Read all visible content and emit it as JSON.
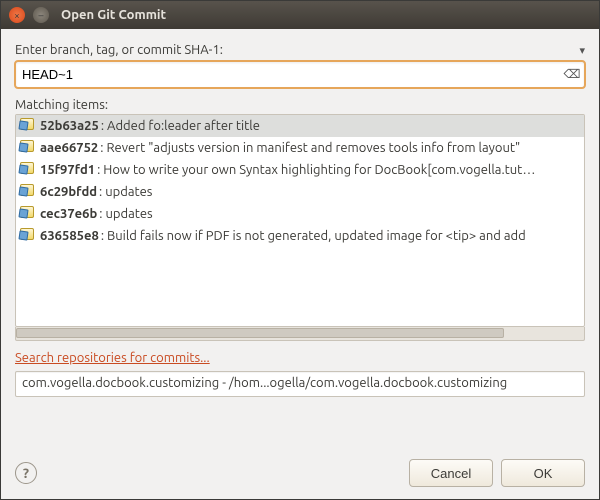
{
  "window": {
    "title": "Open Git Commit"
  },
  "prompt": "Enter branch, tag, or commit SHA-1:",
  "input": {
    "value": "HEAD~1"
  },
  "matching_label": "Matching items:",
  "blur_placeholder": " ",
  "items": [
    {
      "sha": "52b63a25",
      "msg": ": Added fo:leader after title ",
      "blur_w": 232,
      "selected": true
    },
    {
      "sha": "aae66752",
      "msg": ": Revert \"adjusts version in manifest and removes tools info from layout\""
    },
    {
      "sha": "15f97fd1",
      "msg": ": How to write your own Syntax highlighting for DocBook ",
      "pkg": "[com.vogella.tut…"
    },
    {
      "sha": "6c29bfdd",
      "msg": ": updates ",
      "blur_w": 270
    },
    {
      "sha": "cec37e6b",
      "msg": ": updates ",
      "blur_w": 300
    },
    {
      "sha": "636585e8",
      "msg": ": Build fails now if PDF is not generated, updated image for <tip> and add"
    }
  ],
  "search_link": "Search repositories for commits...",
  "repo_box": "com.vogella.docbook.customizing - /hom...ogella/com.vogella.docbook.customizing",
  "buttons": {
    "cancel": "Cancel",
    "ok": "OK"
  }
}
